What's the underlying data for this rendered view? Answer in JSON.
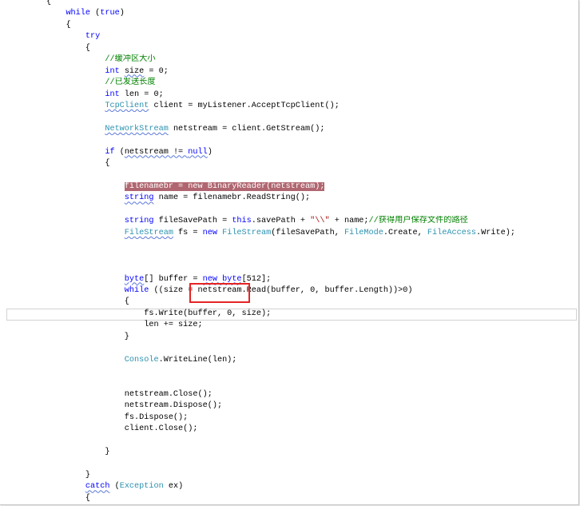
{
  "colors": {
    "keyword": "#0000ff",
    "type": "#2b91af",
    "comment": "#008000",
    "string": "#a31515",
    "text": "#000000",
    "breakpoint_background": "#b06670",
    "breakpoint_text": "#ffffff",
    "squiggle": "#5a78d8",
    "annotation_box": "#e52424"
  },
  "editor": {
    "lines": [
      {
        "tokens": [
          {
            "text": "{",
            "kind": "plain"
          }
        ]
      },
      {
        "tokens": [
          {
            "text": "while",
            "kind": "keyword"
          },
          {
            "text": " (",
            "kind": "plain"
          },
          {
            "text": "true",
            "kind": "keyword"
          },
          {
            "text": ")",
            "kind": "plain"
          }
        ]
      },
      {
        "tokens": [
          {
            "text": "{",
            "kind": "plain"
          }
        ]
      },
      {
        "tokens": [
          {
            "text": "try",
            "kind": "keyword"
          }
        ]
      },
      {
        "tokens": [
          {
            "text": "{",
            "kind": "plain"
          }
        ]
      },
      {
        "tokens": [
          {
            "text": "//缓冲区大小",
            "kind": "comment"
          }
        ]
      },
      {
        "tokens": [
          {
            "text": "int",
            "kind": "keyword"
          },
          {
            "text": " ",
            "kind": "plain"
          },
          {
            "text": "size",
            "kind": "plain",
            "squiggle": true
          },
          {
            "text": " = 0;",
            "kind": "plain"
          }
        ]
      },
      {
        "tokens": [
          {
            "text": "//已发送长度",
            "kind": "comment"
          }
        ]
      },
      {
        "tokens": [
          {
            "text": "int",
            "kind": "keyword"
          },
          {
            "text": " len = 0;",
            "kind": "plain"
          }
        ]
      },
      {
        "tokens": [
          {
            "text": "TcpClient",
            "kind": "type",
            "squiggle": true
          },
          {
            "text": " client = myListener.AcceptTcpClient();",
            "kind": "plain"
          }
        ]
      },
      {
        "tokens": []
      },
      {
        "tokens": [
          {
            "text": "NetworkStream",
            "kind": "type",
            "squiggle": true
          },
          {
            "text": " netstream = client.GetStream();",
            "kind": "plain"
          }
        ]
      },
      {
        "tokens": []
      },
      {
        "tokens": [
          {
            "text": "if",
            "kind": "keyword"
          },
          {
            "text": " (",
            "kind": "plain"
          },
          {
            "text": "netstream != ",
            "kind": "plain",
            "squiggle": true
          },
          {
            "text": "null",
            "kind": "keyword",
            "squiggle": true
          },
          {
            "text": ")",
            "kind": "plain"
          }
        ]
      },
      {
        "tokens": [
          {
            "text": "{",
            "kind": "plain"
          }
        ]
      },
      {
        "tokens": []
      },
      {
        "tokens": [
          {
            "text": "filenamebr = new BinaryReader(netstream);",
            "kind": "breakpoint"
          }
        ]
      },
      {
        "tokens": [
          {
            "text": "string",
            "kind": "keyword",
            "squiggle": true
          },
          {
            "text": " name = filenamebr.ReadString();",
            "kind": "plain"
          }
        ]
      },
      {
        "tokens": []
      },
      {
        "tokens": [
          {
            "text": "string",
            "kind": "keyword"
          },
          {
            "text": " fileSavePath = ",
            "kind": "plain"
          },
          {
            "text": "this",
            "kind": "keyword"
          },
          {
            "text": ".savePath + ",
            "kind": "plain"
          },
          {
            "text": "\"\\\\\"",
            "kind": "string"
          },
          {
            "text": " + name;",
            "kind": "plain"
          },
          {
            "text": "//获得用户保存文件的路径",
            "kind": "comment"
          }
        ]
      },
      {
        "tokens": [
          {
            "text": "FileStream",
            "kind": "type",
            "squiggle": true
          },
          {
            "text": " fs = ",
            "kind": "plain"
          },
          {
            "text": "new",
            "kind": "keyword"
          },
          {
            "text": " ",
            "kind": "plain"
          },
          {
            "text": "FileStream",
            "kind": "type"
          },
          {
            "text": "(fileSavePath, ",
            "kind": "plain"
          },
          {
            "text": "FileMode",
            "kind": "type"
          },
          {
            "text": ".Create, ",
            "kind": "plain"
          },
          {
            "text": "FileAccess",
            "kind": "type"
          },
          {
            "text": ".Write);",
            "kind": "plain"
          }
        ]
      },
      {
        "tokens": []
      },
      {
        "tokens": []
      },
      {
        "tokens": []
      },
      {
        "tokens": [
          {
            "text": "byte",
            "kind": "keyword",
            "squiggle": true
          },
          {
            "text": "[] buffer = ",
            "kind": "plain"
          },
          {
            "text": "new byte",
            "kind": "keyword",
            "squiggle": true
          },
          {
            "text": "[512];",
            "kind": "plain"
          }
        ]
      },
      {
        "tokens": [
          {
            "text": "while",
            "kind": "keyword"
          },
          {
            "text": " ((size = netstream.Read(buffer, 0, buffer.Length))>0)",
            "kind": "plain"
          }
        ]
      },
      {
        "tokens": [
          {
            "text": "{",
            "kind": "plain"
          }
        ]
      },
      {
        "tokens": [
          {
            "text": "fs.Write(buffer, 0, size);",
            "kind": "plain"
          }
        ]
      },
      {
        "tokens": [
          {
            "text": "len += size;",
            "kind": "plain"
          }
        ]
      },
      {
        "tokens": [
          {
            "text": "}",
            "kind": "plain"
          }
        ]
      },
      {
        "tokens": []
      },
      {
        "tokens": [
          {
            "text": "Console",
            "kind": "type"
          },
          {
            "text": ".WriteLine(len);",
            "kind": "plain"
          }
        ]
      },
      {
        "tokens": []
      },
      {
        "tokens": []
      },
      {
        "tokens": [
          {
            "text": "netstream.Close();",
            "kind": "plain"
          }
        ]
      },
      {
        "tokens": [
          {
            "text": "netstream.Dispose();",
            "kind": "plain"
          }
        ]
      },
      {
        "tokens": [
          {
            "text": "fs.Dispose();",
            "kind": "plain"
          }
        ]
      },
      {
        "tokens": [
          {
            "text": "client.Close();",
            "kind": "plain"
          }
        ]
      },
      {
        "tokens": []
      },
      {
        "tokens": [
          {
            "text": "}",
            "kind": "plain"
          }
        ]
      },
      {
        "tokens": []
      },
      {
        "tokens": [
          {
            "text": "}",
            "kind": "plain"
          }
        ]
      },
      {
        "tokens": [
          {
            "text": "catch",
            "kind": "keyword",
            "squiggle": true
          },
          {
            "text": " (",
            "kind": "plain"
          },
          {
            "text": "Exception",
            "kind": "type"
          },
          {
            "text": " ex)",
            "kind": "plain"
          }
        ]
      },
      {
        "tokens": [
          {
            "text": "{",
            "kind": "plain"
          }
        ]
      }
    ]
  }
}
